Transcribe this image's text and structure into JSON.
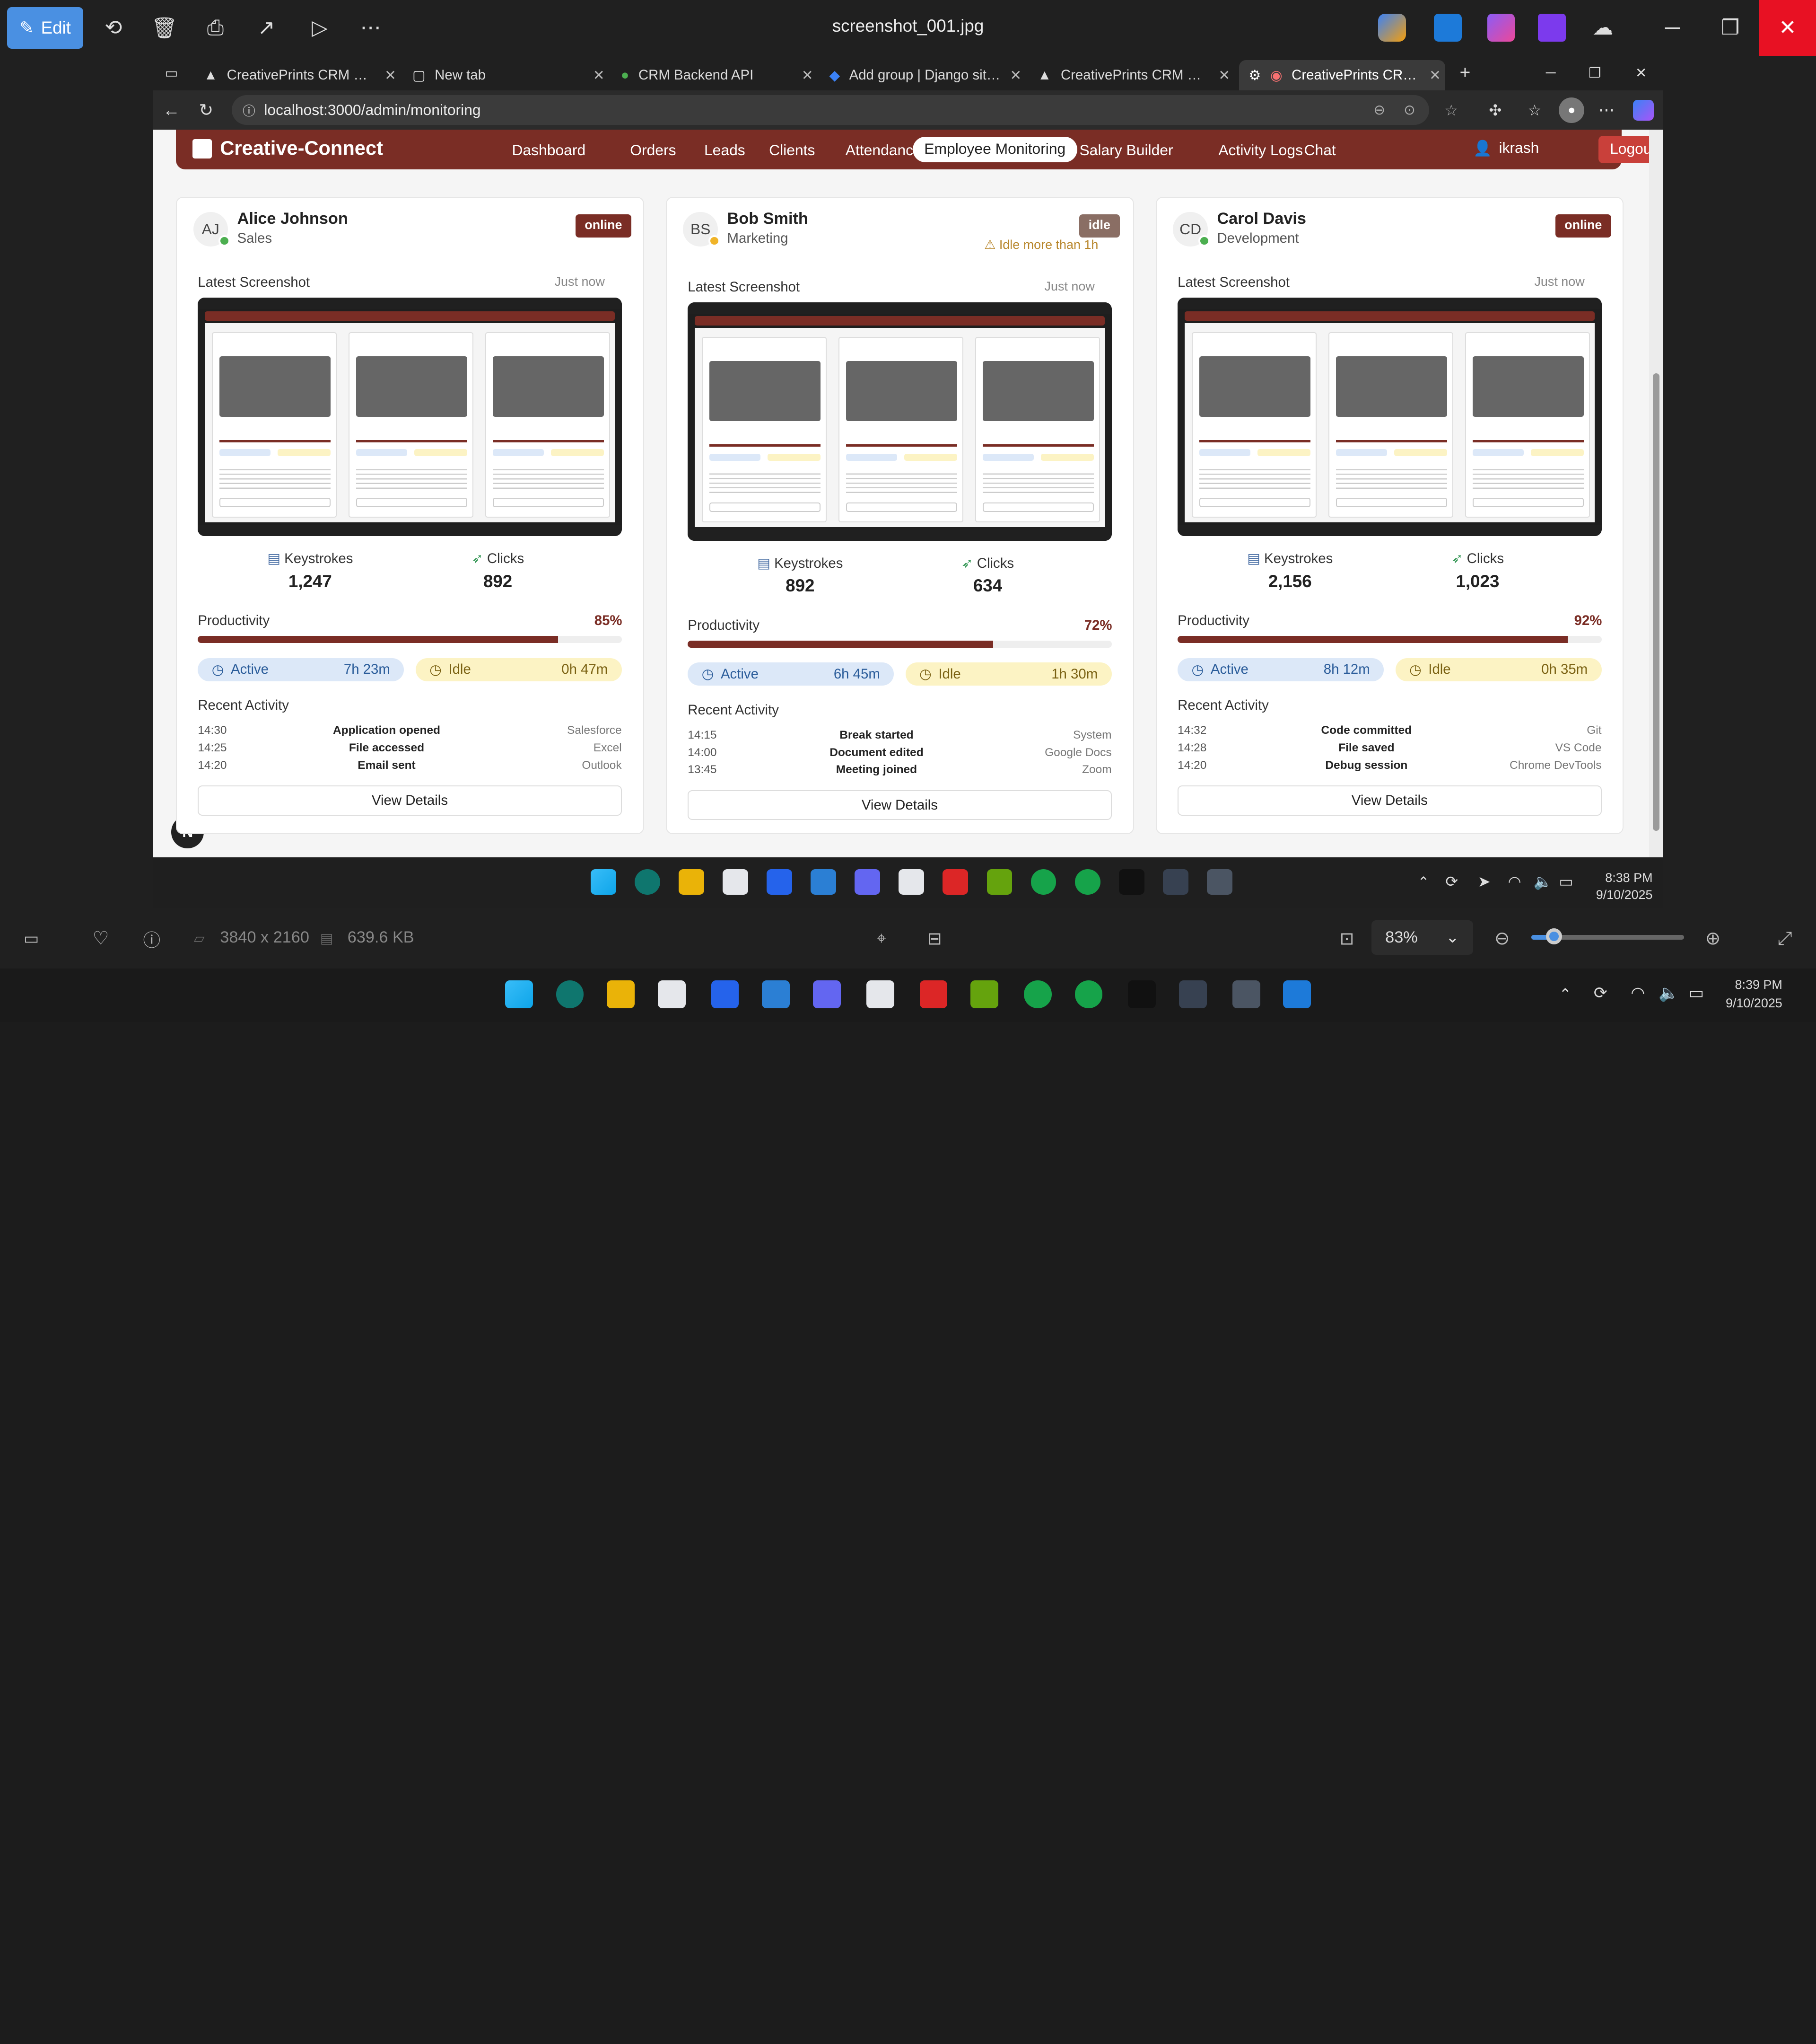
{
  "viewer": {
    "edit_label": "Edit",
    "file_title": "screenshot_001.jpg",
    "dimensions": "3840 x 2160",
    "file_size": "639.6 KB",
    "zoom": "83%",
    "zoom_level": 0.15
  },
  "browser": {
    "tabs": [
      {
        "label": "CreativePrints CRM Dashboa"
      },
      {
        "label": "New tab"
      },
      {
        "label": "CRM Backend API"
      },
      {
        "label": "Add group | Django site adm"
      },
      {
        "label": "CreativePrints CRM Dashboa"
      },
      {
        "label": "CreativePrints CRM Da"
      }
    ],
    "url": "localhost:3000/admin/monitoring"
  },
  "app": {
    "brand": "Creative-Connect",
    "nav": [
      "Dashboard",
      "Orders",
      "Leads",
      "Clients",
      "Attendance",
      "Employee Monitoring",
      "Salary Builder",
      "Activity Logs",
      "Chat"
    ],
    "user": "ikrash",
    "logout": "Logout",
    "floating": "N"
  },
  "labels": {
    "latest_screenshot": "Latest Screenshot",
    "keystrokes": "Keystrokes",
    "clicks": "Clicks",
    "productivity": "Productivity",
    "active": "Active",
    "idle": "Idle",
    "recent_activity": "Recent Activity",
    "view_details": "View Details"
  },
  "employees": [
    {
      "initials": "AJ",
      "name": "Alice Johnson",
      "dept": "Sales",
      "status": "online",
      "warning": "",
      "captured": "Just now",
      "keystrokes": "1,247",
      "clicks": "892",
      "productivity": "85%",
      "productivity_value": 85,
      "active": "7h 23m",
      "idle": "0h 47m",
      "activity": [
        {
          "time": "14:30",
          "desc": "Application opened",
          "src": "Salesforce"
        },
        {
          "time": "14:25",
          "desc": "File accessed",
          "src": "Excel"
        },
        {
          "time": "14:20",
          "desc": "Email sent",
          "src": "Outlook"
        }
      ]
    },
    {
      "initials": "BS",
      "name": "Bob Smith",
      "dept": "Marketing",
      "status": "idle",
      "warning": "Idle more than 1h",
      "captured": "Just now",
      "keystrokes": "892",
      "clicks": "634",
      "productivity": "72%",
      "productivity_value": 72,
      "active": "6h 45m",
      "idle": "1h 30m",
      "activity": [
        {
          "time": "14:15",
          "desc": "Break started",
          "src": "System"
        },
        {
          "time": "14:00",
          "desc": "Document edited",
          "src": "Google Docs"
        },
        {
          "time": "13:45",
          "desc": "Meeting joined",
          "src": "Zoom"
        }
      ]
    },
    {
      "initials": "CD",
      "name": "Carol Davis",
      "dept": "Development",
      "status": "online",
      "warning": "",
      "captured": "Just now",
      "keystrokes": "2,156",
      "clicks": "1,023",
      "productivity": "92%",
      "productivity_value": 92,
      "active": "8h 12m",
      "idle": "0h 35m",
      "activity": [
        {
          "time": "14:32",
          "desc": "Code committed",
          "src": "Git"
        },
        {
          "time": "14:28",
          "desc": "File saved",
          "src": "VS Code"
        },
        {
          "time": "14:20",
          "desc": "Debug session",
          "src": "Chrome DevTools"
        }
      ]
    }
  ],
  "clock_inner": {
    "time": "8:38 PM",
    "date": "9/10/2025"
  },
  "clock_host": {
    "time": "8:39 PM",
    "date": "9/10/2025"
  },
  "colors": {
    "brand": "#7a2d25",
    "online": "#7a2d25",
    "idle_badge": "#8a6e64",
    "active_pill": "#dce8f8",
    "idle_pill": "#fcf3c4",
    "accent": "#4a90e2"
  }
}
